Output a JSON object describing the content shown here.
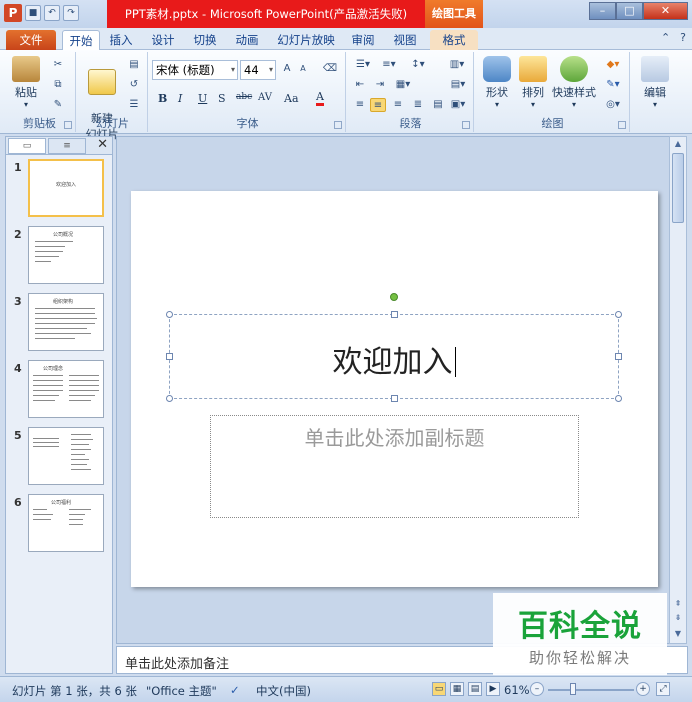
{
  "titlebar": {
    "title": "PPT素材.pptx - Microsoft PowerPoint(产品激活失败)",
    "context_tool": "绘图工具",
    "app_icon": "P"
  },
  "tabs": {
    "file": "文件",
    "items": [
      "开始",
      "插入",
      "设计",
      "切换",
      "动画",
      "幻灯片放映",
      "审阅",
      "视图",
      "格式"
    ],
    "active": "开始"
  },
  "ribbon": {
    "clipboard": {
      "paste": "粘贴",
      "label": "剪贴板"
    },
    "slides": {
      "new_slide": "新建\n幻灯片",
      "label": "幻灯片"
    },
    "font": {
      "name": "宋体 (标题)",
      "size": "44",
      "label": "字体",
      "bold": "B",
      "italic": "I",
      "underline": "U",
      "strike": "S",
      "shadow": "abc",
      "spacing": "AV",
      "case": "Aa",
      "color": "A"
    },
    "paragraph": {
      "label": "段落"
    },
    "drawing": {
      "shape": "形状",
      "arrange": "排列",
      "quick_styles": "快速样式",
      "label": "绘图"
    },
    "editing": {
      "edit": "编辑"
    }
  },
  "thumbnails": [
    {
      "num": "1",
      "title": "欢迎加入",
      "selected": true
    },
    {
      "num": "2",
      "title": "公司概况",
      "selected": false
    },
    {
      "num": "3",
      "title": "组织架构",
      "selected": false
    },
    {
      "num": "4",
      "title": "公司理念",
      "selected": false
    },
    {
      "num": "5",
      "title": "",
      "selected": false
    },
    {
      "num": "6",
      "title": "公司福利",
      "selected": false
    }
  ],
  "slide": {
    "title": "欢迎加入",
    "subtitle_placeholder": "单击此处添加副标题"
  },
  "notes": {
    "placeholder": "单击此处添加备注"
  },
  "watermark": {
    "big": "百科全说",
    "small": "助你轻松解决"
  },
  "statusbar": {
    "slide_info": "幻灯片 第 1 张，共 6 张",
    "theme": "\"Office 主题\"",
    "language": "中文(中国)",
    "zoom": "61%"
  },
  "colors": {
    "accent_red": "#e81a1a",
    "context_orange": "#e2541b",
    "file_tab": "#c8441a",
    "watermark_green": "#1aa33a"
  }
}
